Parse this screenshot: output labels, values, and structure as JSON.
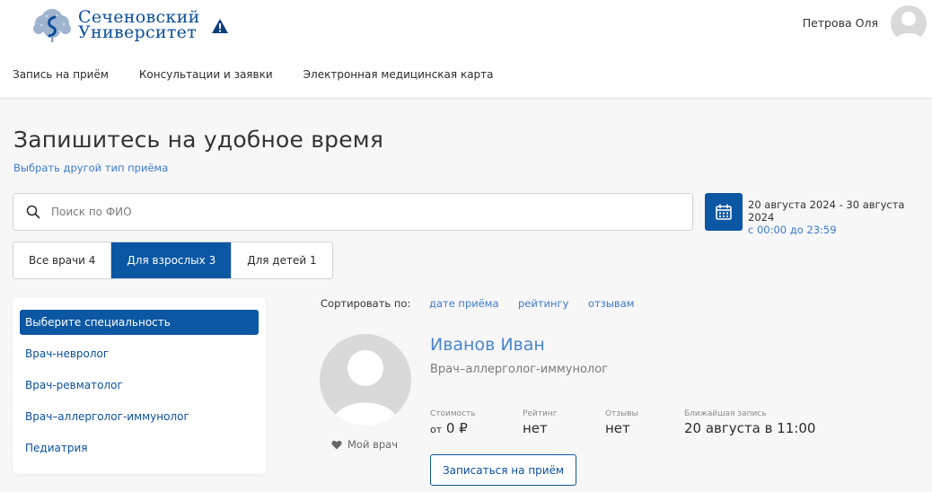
{
  "header": {
    "logo_line1": "Сеченовский",
    "logo_line2": "Университет",
    "user_name": "Петрова Оля"
  },
  "nav": {
    "items": [
      {
        "label": "Запись на приём"
      },
      {
        "label": "Консультации и заявки"
      },
      {
        "label": "Электронная медицинская карта"
      }
    ]
  },
  "page": {
    "title": "Запишитесь на удобное время",
    "change_type_link": "Выбрать другой тип приёма"
  },
  "search": {
    "placeholder": "Поиск по ФИО",
    "value": ""
  },
  "date_filter": {
    "range": "20 августа 2024 - 30 августа 2024",
    "time": "с 00:00 до 23:59"
  },
  "tabs": [
    {
      "label": "Все врачи 4",
      "active": false
    },
    {
      "label": "Для взрослых 3",
      "active": true
    },
    {
      "label": "Для детей 1",
      "active": false
    }
  ],
  "specialties": [
    {
      "label": "Выберите специальность",
      "active": true
    },
    {
      "label": "Врач-невролог",
      "active": false
    },
    {
      "label": "Врач-ревматолог",
      "active": false
    },
    {
      "label": "Врач–аллерголог-иммунолог",
      "active": false
    },
    {
      "label": "Педиатрия",
      "active": false
    }
  ],
  "sort": {
    "label": "Сортировать по:",
    "options": [
      "дате приёма",
      "рейтингу",
      "отзывам"
    ]
  },
  "doctor": {
    "name": "Иванов Иван",
    "specialty": "Врач–аллерголог-иммунолог",
    "favorite_label": "Мой врач",
    "cost_label": "Стоимость",
    "cost_prefix": "от",
    "cost_value": "0 ₽",
    "rating_label": "Рейтинг",
    "rating_value": "нет",
    "reviews_label": "Отзывы",
    "reviews_value": "нет",
    "next_label": "Ближайшая запись",
    "next_value": "20 августа в 11:00",
    "book_button": "Записаться на приём"
  },
  "colors": {
    "brand": "#0b57a4",
    "link": "#3d7bc8",
    "warning": "#0b3d7a"
  },
  "icons": {
    "logo": "university-tree-logo",
    "warning": "warning-triangle-icon",
    "search": "search-icon",
    "calendar": "calendar-icon",
    "favorite": "heart-icon",
    "avatar": "user-avatar-icon"
  }
}
